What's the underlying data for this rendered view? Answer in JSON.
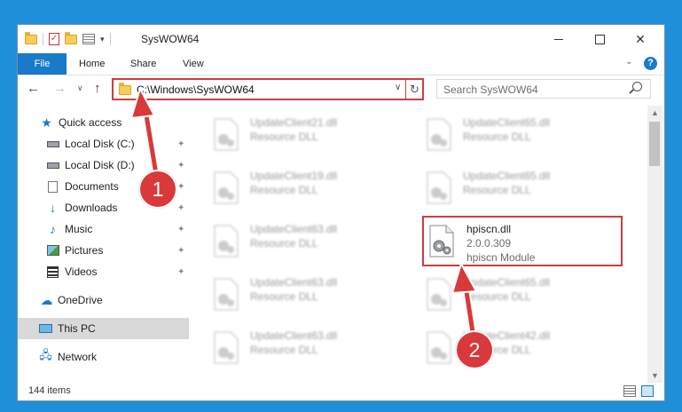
{
  "window": {
    "title": "SysWOW64",
    "min_glyph": "",
    "close_glyph": "✕"
  },
  "ribbon": {
    "tabs": [
      "File",
      "Home",
      "Share",
      "View"
    ],
    "expand_glyph": "⌄",
    "help_glyph": "?"
  },
  "nav": {
    "back_glyph": "←",
    "forward_glyph": "→",
    "recent_glyph": "∨",
    "up_glyph": "↑",
    "address": "C:\\Windows\\SysWOW64",
    "address_dropdown_glyph": "∨",
    "refresh_glyph": "↻",
    "search_placeholder": "Search SysWOW64"
  },
  "sidebar": {
    "items": [
      {
        "label": "Quick access",
        "icon": "star-icon"
      },
      {
        "label": "Local Disk (C:)",
        "icon": "drive-icon",
        "pinned": true
      },
      {
        "label": "Local Disk (D:)",
        "icon": "drive-icon",
        "pinned": true
      },
      {
        "label": "Documents",
        "icon": "documents-icon",
        "pinned": true
      },
      {
        "label": "Downloads",
        "icon": "download-icon",
        "pinned": true
      },
      {
        "label": "Music",
        "icon": "music-icon",
        "pinned": true
      },
      {
        "label": "Pictures",
        "icon": "pictures-icon",
        "pinned": true
      },
      {
        "label": "Videos",
        "icon": "videos-icon",
        "pinned": true
      },
      {
        "label": "OneDrive",
        "icon": "cloud-icon"
      },
      {
        "label": "This PC",
        "icon": "pc-icon",
        "selected": true
      },
      {
        "label": "Network",
        "icon": "network-icon"
      }
    ],
    "pin_glyph": "📌"
  },
  "files": [
    {
      "name": "UpdateClient21.dll",
      "type": "Resource DLL"
    },
    {
      "name": "UpdateClient65.dll",
      "type": "Resource DLL"
    },
    {
      "name": "UpdateClient19.dll",
      "type": "Resource DLL"
    },
    {
      "name": "UpdateClient65.dll",
      "type": "Resource DLL"
    },
    {
      "name": "UpdateClient63.dll",
      "type": "Resource DLL"
    },
    {
      "name": "UpdateClient63.dll",
      "type": "Resource DLL"
    },
    {
      "name": "UpdateClient65.dll",
      "type": "Resource DLL"
    },
    {
      "name": "UpdateClient63.dll",
      "type": "Resource DLL"
    },
    {
      "name": "UpdateClient42.dll",
      "type": "Resource DLL"
    }
  ],
  "highlighted_file": {
    "name": "hpiscn.dll",
    "version": "2.0.0.309",
    "type": "hpiscn Module"
  },
  "status": {
    "item_count": "144 items"
  },
  "annotations": {
    "step1": "1",
    "step2": "2",
    "color": "#d9393b"
  },
  "colors": {
    "accent": "#1979ca",
    "highlight_border": "#d23c3c",
    "desktop": "#1f8fd9"
  }
}
